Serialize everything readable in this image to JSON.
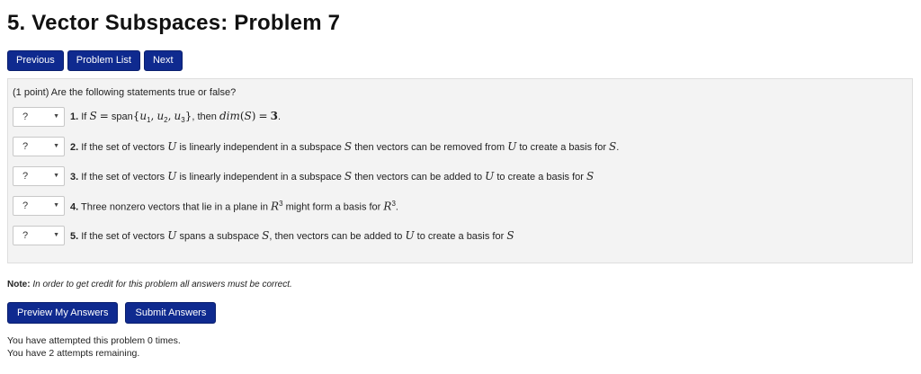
{
  "page": {
    "title": "5. Vector Subspaces: Problem 7"
  },
  "nav": {
    "previous_label": "Previous",
    "problem_list_label": "Problem List",
    "next_label": "Next"
  },
  "problem": {
    "intro": "(1 point) Are the following statements true or false?",
    "questions": [
      {
        "select_value": "?",
        "number": "1."
      },
      {
        "select_value": "?",
        "number": "2."
      },
      {
        "select_value": "?",
        "number": "3."
      },
      {
        "select_value": "?",
        "number": "4."
      },
      {
        "select_value": "?",
        "number": "5."
      }
    ],
    "q1": {
      "if": "If",
      "span_word": "span",
      "then": ", then",
      "dim": "dim",
      "value": "3"
    },
    "q2": {
      "text_a": "If the set of vectors",
      "text_b": "is linearly independent in a subspace",
      "text_c": "then vectors can be removed from",
      "text_d": "to create a basis for"
    },
    "q3": {
      "text_a": "If the set of vectors",
      "text_b": "is linearly independent in a subspace",
      "text_c": "then vectors can be added to",
      "text_d": "to create a basis for"
    },
    "q4": {
      "text_a": "Three nonzero vectors that lie in a plane in",
      "text_b": "might form a basis for",
      "exp": "3"
    },
    "q5": {
      "text_a": "If the set of vectors",
      "text_b": "spans a subspace",
      "text_c": ", then vectors can be added to",
      "text_d": "to create a basis for"
    }
  },
  "note": {
    "label": "Note:",
    "text": "In order to get credit for this problem all answers must be correct."
  },
  "actions": {
    "preview_label": "Preview My Answers",
    "submit_label": "Submit Answers"
  },
  "status": {
    "attempted": "You have attempted this problem 0 times.",
    "remaining": "You have 2 attempts remaining."
  },
  "colors": {
    "button_bg": "#0f2a8f",
    "problem_bg": "#f3f3f3"
  }
}
